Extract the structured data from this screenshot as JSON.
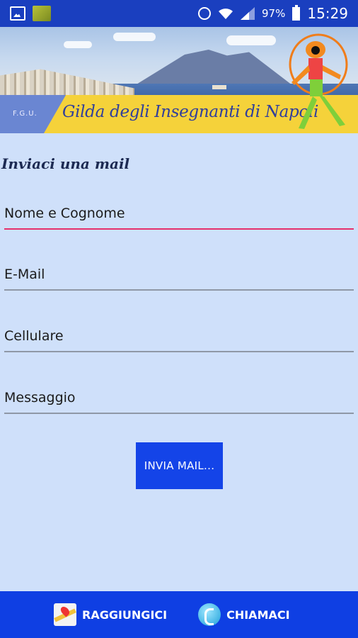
{
  "status_bar": {
    "battery": "97%",
    "time": "15:29"
  },
  "banner": {
    "org_short": "F.G.U.",
    "org_name": "Gilda degli Insegnanti di Napoli"
  },
  "form": {
    "title": "Inviaci una mail",
    "fields": [
      {
        "label": "Nome e Cognome"
      },
      {
        "label": "E-Mail"
      },
      {
        "label": "Cellulare"
      },
      {
        "label": "Messaggio"
      }
    ],
    "submit_label": "INVIA MAIL..."
  },
  "bottom_bar": {
    "reach_label": "RAGGIUNGICI",
    "call_label": "CHIAMACI"
  },
  "colors": {
    "status_bar": "#1a3fbf",
    "background": "#cfe0fa",
    "accent_focus_line": "#e5306c",
    "button": "#1444e8",
    "bottom_bar": "#0f3fe3"
  }
}
